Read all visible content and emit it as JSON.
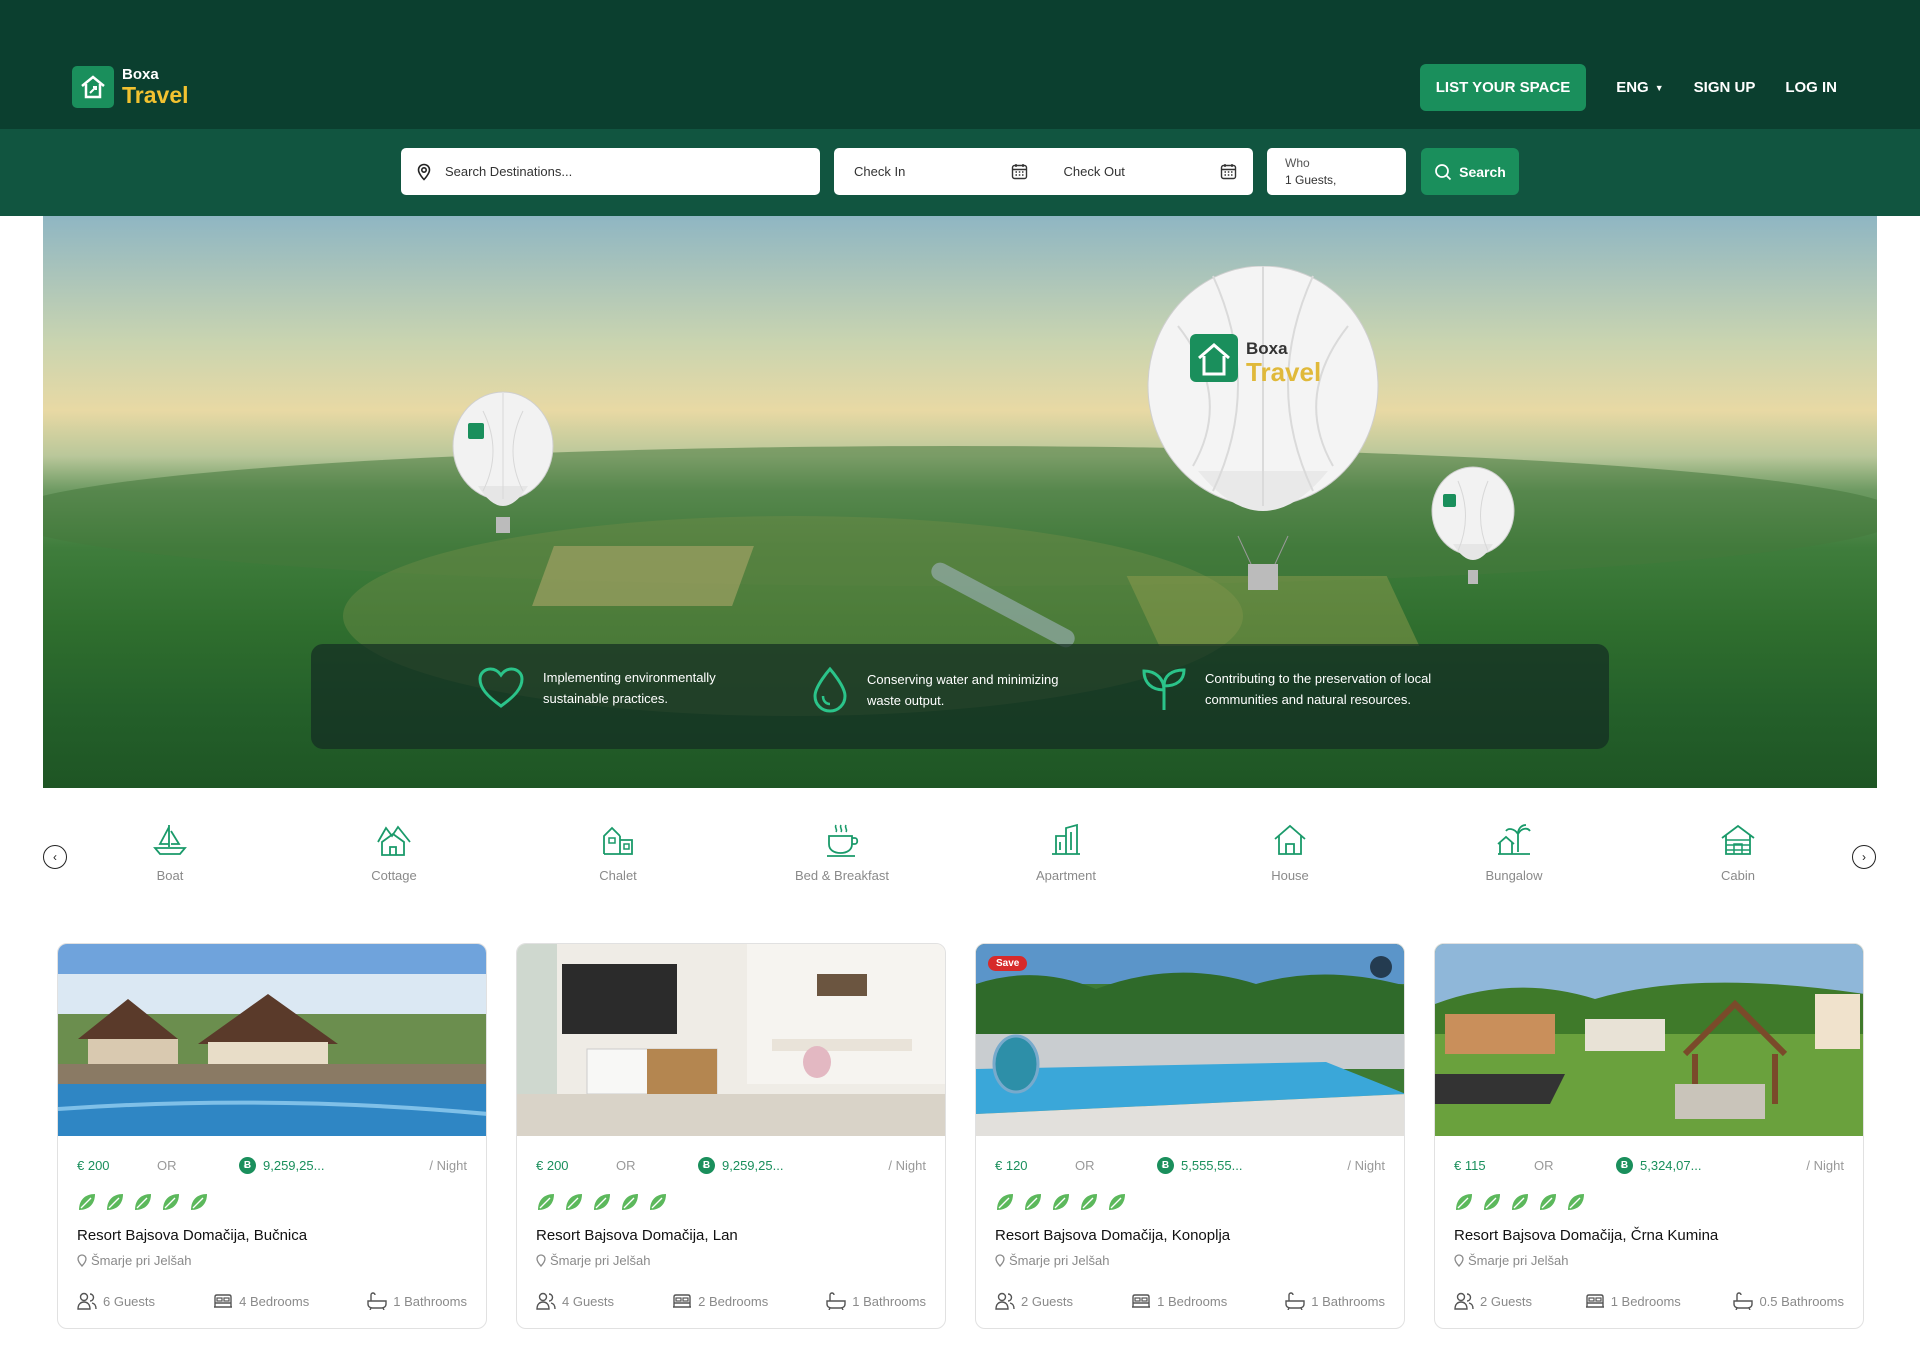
{
  "brand": {
    "name_top": "Boxa",
    "name_bottom": "Travel"
  },
  "nav": {
    "list_space": "LIST YOUR SPACE",
    "language": "ENG",
    "signup": "SIGN UP",
    "login": "LOG IN"
  },
  "search": {
    "destination_placeholder": "Search Destinations...",
    "check_in": "Check In",
    "check_out": "Check Out",
    "who_label": "Who",
    "who_value": "1 Guests,",
    "button": "Search"
  },
  "hero": {
    "features": [
      {
        "icon": "heart-icon",
        "text": "Implementing environmentally sustainable practices."
      },
      {
        "icon": "water-drop-icon",
        "text": "Conserving water and minimizing waste output."
      },
      {
        "icon": "sprout-icon",
        "text": "Contributing to the preservation of local communities and natural resources."
      }
    ]
  },
  "categories": [
    {
      "label": "Boat",
      "icon": "boat-icon"
    },
    {
      "label": "Cottage",
      "icon": "cottage-icon"
    },
    {
      "label": "Chalet",
      "icon": "chalet-icon"
    },
    {
      "label": "Bed & Breakfast",
      "icon": "coffee-cup-icon"
    },
    {
      "label": "Apartment",
      "icon": "apartment-icon"
    },
    {
      "label": "House",
      "icon": "house-icon"
    },
    {
      "label": "Bungalow",
      "icon": "bungalow-icon"
    },
    {
      "label": "Cabin",
      "icon": "cabin-icon"
    }
  ],
  "listing_common": {
    "or": "OR",
    "per_night": "/ Night",
    "save": "Save"
  },
  "listings": [
    {
      "price_eur": "€  200",
      "price_coin": "9,259,25...",
      "rating": 5,
      "title": "Resort Bajsova Domačija, Bučnica",
      "location": "Šmarje pri Jelšah",
      "guests": "6 Guests",
      "bedrooms": "4 Bedrooms",
      "bathrooms": "1 Bathrooms"
    },
    {
      "price_eur": "€  200",
      "price_coin": "9,259,25...",
      "rating": 5,
      "title": "Resort Bajsova Domačija, Lan",
      "location": "Šmarje pri Jelšah",
      "guests": "4 Guests",
      "bedrooms": "2 Bedrooms",
      "bathrooms": "1 Bathrooms"
    },
    {
      "price_eur": "€  120",
      "price_coin": "5,555,55...",
      "rating": 5,
      "title": "Resort Bajsova Domačija, Konoplja",
      "location": "Šmarje pri Jelšah",
      "guests": "2 Guests",
      "bedrooms": "1 Bedrooms",
      "bathrooms": "1 Bathrooms"
    },
    {
      "price_eur": "€  115",
      "price_coin": "5,324,07...",
      "rating": 5,
      "title": "Resort Bajsova Domačija, Črna Kumina",
      "location": "Šmarje pri Jelšah",
      "guests": "2 Guests",
      "bedrooms": "1 Bedrooms",
      "bathrooms": "0.5 Bathrooms"
    }
  ],
  "colors": {
    "header": "#0b3f2f",
    "search_band": "#115540",
    "accent": "#1a8f5c",
    "logo_gold": "#f2c230",
    "leaf": "#5cb85c"
  }
}
